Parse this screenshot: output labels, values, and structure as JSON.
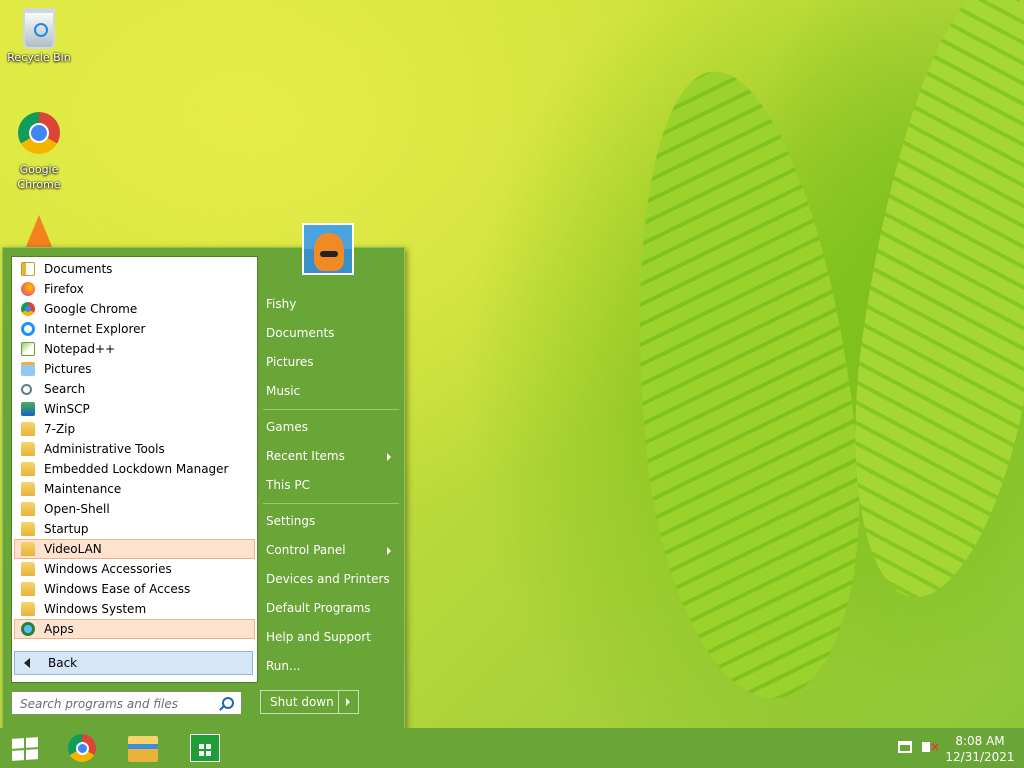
{
  "desktop": {
    "icons": [
      {
        "label": "Recycle Bin",
        "icon": "recycle-bin-icon"
      },
      {
        "label": "Google Chrome",
        "icon": "chrome-icon"
      },
      {
        "label": "",
        "icon": "vlc-icon"
      }
    ]
  },
  "start_menu": {
    "programs": [
      {
        "label": "Documents",
        "icon": "documents-icon"
      },
      {
        "label": "Firefox",
        "icon": "firefox-icon"
      },
      {
        "label": "Google Chrome",
        "icon": "chrome-icon"
      },
      {
        "label": "Internet Explorer",
        "icon": "internet-explorer-icon"
      },
      {
        "label": "Notepad++",
        "icon": "notepadpp-icon"
      },
      {
        "label": "Pictures",
        "icon": "pictures-icon"
      },
      {
        "label": "Search",
        "icon": "search-icon"
      },
      {
        "label": "WinSCP",
        "icon": "winscp-icon"
      },
      {
        "label": "7-Zip",
        "icon": "folder-icon"
      },
      {
        "label": "Administrative Tools",
        "icon": "folder-icon"
      },
      {
        "label": "Embedded Lockdown Manager",
        "icon": "folder-icon"
      },
      {
        "label": "Maintenance",
        "icon": "folder-icon"
      },
      {
        "label": "Open-Shell",
        "icon": "folder-icon"
      },
      {
        "label": "Startup",
        "icon": "folder-icon"
      },
      {
        "label": "VideoLAN",
        "icon": "folder-icon",
        "highlighted": true
      },
      {
        "label": "Windows Accessories",
        "icon": "folder-icon"
      },
      {
        "label": "Windows Ease of Access",
        "icon": "folder-icon"
      },
      {
        "label": "Windows System",
        "icon": "folder-icon"
      },
      {
        "label": "Apps",
        "icon": "apps-icon",
        "highlighted": true
      }
    ],
    "back_label": "Back",
    "search_placeholder": "Search programs and files",
    "user_name": "Fishy",
    "right_items": [
      {
        "label": "Fishy"
      },
      {
        "label": "Documents"
      },
      {
        "label": "Pictures"
      },
      {
        "label": "Music"
      },
      {
        "label": "Games"
      },
      {
        "label": "Recent Items",
        "submenu": true
      },
      {
        "label": "This PC"
      },
      {
        "label": "Settings"
      },
      {
        "label": "Control Panel",
        "submenu": true
      },
      {
        "label": "Devices and Printers"
      },
      {
        "label": "Default Programs"
      },
      {
        "label": "Help and Support"
      },
      {
        "label": "Run..."
      }
    ],
    "shutdown_label": "Shut down"
  },
  "taskbar": {
    "pinned": [
      {
        "icon": "start-icon"
      },
      {
        "icon": "chrome-icon"
      },
      {
        "icon": "file-explorer-icon"
      },
      {
        "icon": "store-icon"
      }
    ],
    "tray": {
      "time": "8:08 AM",
      "date": "12/31/2021",
      "network_icon": "network-icon",
      "volume_icon": "volume-muted-icon"
    }
  },
  "colors": {
    "accent": "#6aa537",
    "highlight": "#fde2d0",
    "back_bg": "#d5e6f7"
  }
}
